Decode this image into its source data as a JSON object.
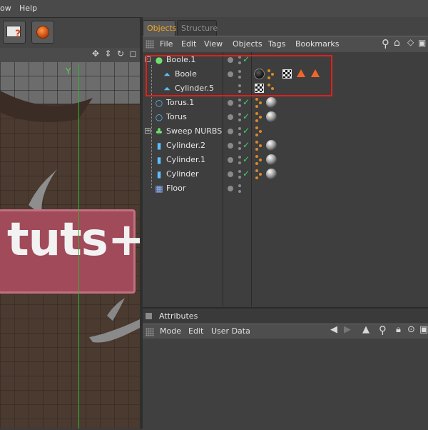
{
  "menubar": {
    "items": [
      {
        "label": "ow"
      },
      {
        "label": "Help"
      }
    ]
  },
  "viewport": {
    "axis_label": "Y",
    "scene_text": "tuts+"
  },
  "objects_panel": {
    "tabs": [
      {
        "label": "Objects",
        "active": true
      },
      {
        "label": "Structure",
        "active": false
      }
    ],
    "menu": [
      {
        "label": "File"
      },
      {
        "label": "Edit"
      },
      {
        "label": "View"
      },
      {
        "label": "Objects"
      },
      {
        "label": "Tags"
      },
      {
        "label": "Bookmarks"
      }
    ],
    "rows": [
      {
        "name": "Boole.1",
        "icon": "boole-icon",
        "check": true,
        "tags": []
      },
      {
        "name": "Boole",
        "icon": "bone-icon",
        "check": false,
        "tags": [
          "dark-material-tag",
          "phong-tag",
          "checker-material-tag",
          "triangle-tag",
          "triangle-tag"
        ]
      },
      {
        "name": "Cylinder.5",
        "icon": "bone-icon",
        "check": false,
        "tags": [
          "checker-material-tag",
          "phong-tag"
        ]
      },
      {
        "name": "Torus.1",
        "icon": "torus-icon",
        "check": true,
        "tags": [
          "phong-tag",
          "material-tag"
        ]
      },
      {
        "name": "Torus",
        "icon": "torus-icon",
        "check": true,
        "tags": [
          "phong-tag",
          "material-tag"
        ]
      },
      {
        "name": "Sweep NURBS",
        "icon": "sweep-nurbs-icon",
        "check": true,
        "tags": [
          "phong-tag"
        ]
      },
      {
        "name": "Cylinder.2",
        "icon": "cylinder-icon",
        "check": true,
        "tags": [
          "phong-tag",
          "material-tag"
        ]
      },
      {
        "name": "Cylinder.1",
        "icon": "cylinder-icon",
        "check": true,
        "tags": [
          "phong-tag",
          "material-tag"
        ]
      },
      {
        "name": "Cylinder",
        "icon": "cylinder-icon",
        "check": true,
        "tags": [
          "phong-tag",
          "material-tag"
        ]
      },
      {
        "name": "Floor",
        "icon": "floor-icon",
        "check": false,
        "tags": []
      }
    ]
  },
  "attributes_panel": {
    "title": "Attributes",
    "menu": [
      {
        "label": "Mode"
      },
      {
        "label": "Edit"
      },
      {
        "label": "User Data"
      }
    ]
  },
  "colors": {
    "active_tab": "#f2a623",
    "check": "#3fd46a",
    "highlight": "#e0201a",
    "axis": "#2fb42f"
  }
}
